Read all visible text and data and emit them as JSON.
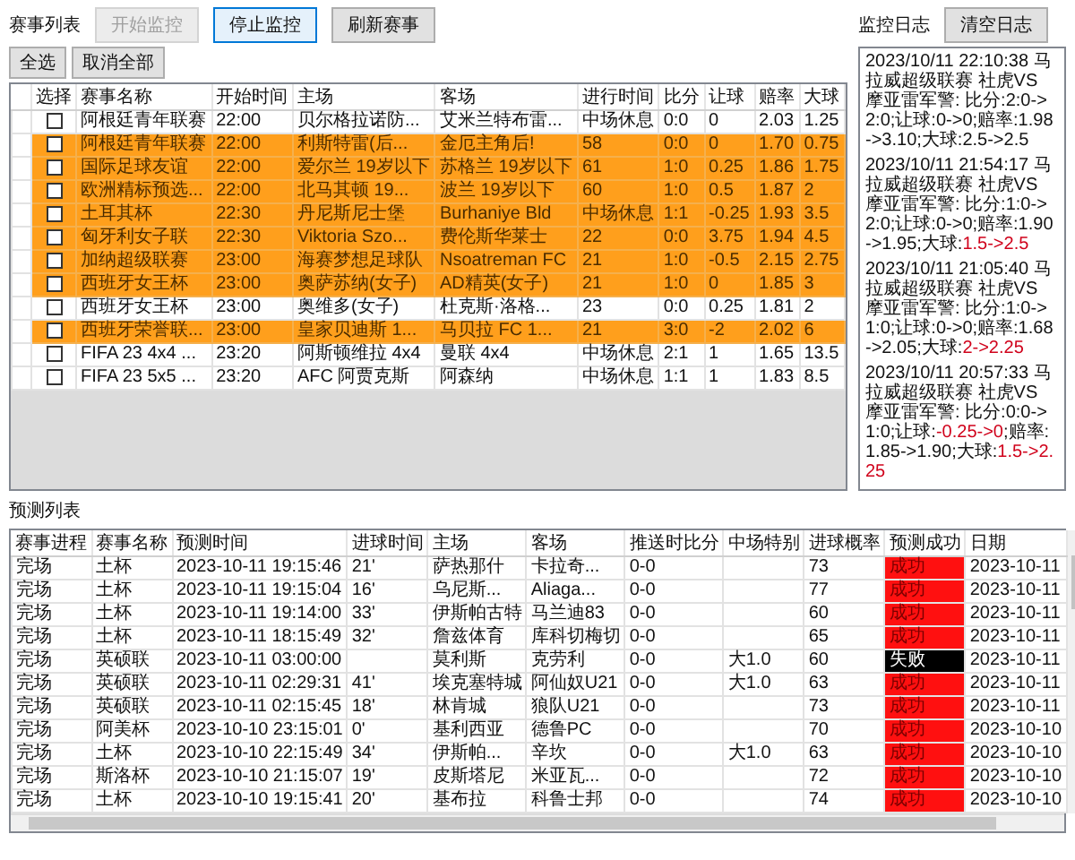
{
  "event_list": {
    "label": "赛事列表",
    "buttons": [
      {
        "label": "开始监控",
        "disabled": true,
        "focused": false
      },
      {
        "label": "停止监控",
        "disabled": false,
        "focused": true
      },
      {
        "label": "刷新赛事",
        "disabled": false,
        "focused": false
      }
    ],
    "select_buttons": [
      "全选",
      "取消全部"
    ],
    "table": {
      "columns": [
        "选择",
        "赛事名称",
        "开始时间",
        "主场",
        "客场",
        "进行时间",
        "比分",
        "让球",
        "赔率",
        "大球"
      ],
      "rows": [
        {
          "checked": false,
          "selected": false,
          "cells": [
            "",
            "阿根廷青年联赛",
            "22:00",
            "贝尔格拉诺防...",
            "艾米兰特布雷...",
            "中场休息",
            "0:0",
            "0",
            "2.03",
            "1.25"
          ]
        },
        {
          "checked": false,
          "selected": true,
          "cells": [
            "",
            "阿根廷青年联赛",
            "22:00",
            "利斯特雷(后...",
            "金厄主角后!",
            "58",
            "0:0",
            "0",
            "1.70",
            "0.75"
          ]
        },
        {
          "checked": false,
          "selected": true,
          "cells": [
            "",
            "国际足球友谊",
            "22:00",
            "爱尔兰 19岁以下",
            "苏格兰 19岁以下",
            "61",
            "1:0",
            "0.25",
            "1.86",
            "1.75"
          ]
        },
        {
          "checked": false,
          "selected": true,
          "cells": [
            "",
            "欧洲精标预选...",
            "22:00",
            "北马其顿 19...",
            "波兰 19岁以下",
            "60",
            "1:0",
            "0.5",
            "1.87",
            "2"
          ]
        },
        {
          "checked": false,
          "selected": true,
          "cells": [
            "",
            "土耳其杯",
            "22:30",
            "丹尼斯尼士堡",
            "Burhaniye Bld",
            "中场休息",
            "1:1",
            "-0.25",
            "1.93",
            "3.5"
          ]
        },
        {
          "checked": false,
          "selected": true,
          "cells": [
            "",
            "匈牙利女子联",
            "22:30",
            "Viktoria Szo...",
            "费伦斯华莱士",
            "22",
            "0:0",
            "3.75",
            "1.94",
            "4.5"
          ]
        },
        {
          "checked": false,
          "selected": true,
          "cells": [
            "",
            "加纳超级联赛",
            "23:00",
            "海赛梦想足球队",
            "Nsoatreman FC",
            "21",
            "1:0",
            "-0.5",
            "2.15",
            "2.75"
          ]
        },
        {
          "checked": false,
          "selected": true,
          "cells": [
            "",
            "西班牙女王杯",
            "23:00",
            "奥萨苏纳(女子)",
            "AD精英(女子)",
            "21",
            "1:0",
            "0",
            "1.85",
            "3"
          ]
        },
        {
          "checked": false,
          "selected": false,
          "cells": [
            "",
            "西班牙女王杯",
            "23:00",
            "奥维多(女子)",
            "杜克斯·洛格...",
            "23",
            "0:0",
            "0.25",
            "1.81",
            "2"
          ]
        },
        {
          "checked": false,
          "selected": true,
          "cells": [
            "",
            "西班牙荣誉联...",
            "23:00",
            "皇家贝迪斯 1...",
            "马贝拉 FC 1...",
            "21",
            "3:0",
            "-2",
            "2.02",
            "6"
          ]
        },
        {
          "checked": false,
          "selected": false,
          "cells": [
            "",
            "FIFA 23 4x4 ...",
            "23:20",
            "阿斯顿维拉 4x4",
            "曼联 4x4",
            "中场休息",
            "2:1",
            "1",
            "1.65",
            "13.5"
          ]
        },
        {
          "checked": false,
          "selected": false,
          "cells": [
            "",
            "FIFA 23 5x5 ...",
            "23:20",
            "AFC 阿贾克斯",
            "阿森纳",
            "中场休息",
            "1:1",
            "1",
            "1.83",
            "8.5"
          ]
        }
      ]
    }
  },
  "monitor_log": {
    "label": "监控日志",
    "clear_button": "清空日志",
    "entries": [
      {
        "segments": [
          {
            "text": "2023/10/11 22:10:38 马拉威超级联赛 社虎VS 摩亚雷军警: 比分:2:0->2:0;让球:0->0;赔率:1.98->3.10;大球:2.5->2.5",
            "changed": false
          }
        ]
      },
      {
        "segments": [
          {
            "text": "2023/10/11 21:54:17 马拉威超级联赛 社虎VS 摩亚雷军警: 比分:1:0->2:0;让球:0->0;赔率:1.90->1.95;大球:",
            "changed": false
          },
          {
            "text": "1.5->2.5",
            "changed": true
          }
        ]
      },
      {
        "segments": [
          {
            "text": "2023/10/11 21:05:40 马拉威超级联赛 社虎VS 摩亚雷军警: 比分:1:0->1:0;让球:0->0;赔率:1.68->2.05;大球:",
            "changed": false
          },
          {
            "text": "2->2.25",
            "changed": true
          }
        ]
      },
      {
        "segments": [
          {
            "text": "2023/10/11 20:57:33 马拉威超级联赛 社虎VS 摩亚雷军警: 比分:0:0->1:0;让球:",
            "changed": false
          },
          {
            "text": "-0.25->0",
            "changed": true
          },
          {
            "text": ";赔率:1.85->1.90;大球:",
            "changed": false
          },
          {
            "text": "1.5->2.25",
            "changed": true
          }
        ]
      }
    ]
  },
  "prediction_list": {
    "label": "预测列表",
    "table": {
      "columns": [
        "赛事进程",
        "赛事名称",
        "预测时间",
        "进球时间",
        "主场",
        "客场",
        "推送时比分",
        "中场特别",
        "进球概率",
        "预测成功",
        "日期"
      ],
      "rows": [
        {
          "success": true,
          "cells": [
            "完场",
            "土杯",
            "2023-10-11 19:15:46",
            "21'",
            "萨热那什",
            "卡拉奇...",
            "0-0",
            "",
            "73",
            "成功",
            "2023-10-11"
          ]
        },
        {
          "success": true,
          "cells": [
            "完场",
            "土杯",
            "2023-10-11 19:15:04",
            "16'",
            "乌尼斯...",
            "Aliaga...",
            "0-0",
            "",
            "77",
            "成功",
            "2023-10-11"
          ]
        },
        {
          "success": true,
          "cells": [
            "完场",
            "土杯",
            "2023-10-11 19:14:00",
            "33'",
            "伊斯帕古特",
            "马兰迪83",
            "0-0",
            "",
            "60",
            "成功",
            "2023-10-11"
          ]
        },
        {
          "success": true,
          "cells": [
            "完场",
            "土杯",
            "2023-10-11 18:15:49",
            "32'",
            "詹兹体育",
            "库科切梅切",
            "0-0",
            "",
            "65",
            "成功",
            "2023-10-11"
          ]
        },
        {
          "success": false,
          "cells": [
            "完场",
            "英硕联",
            "2023-10-11 03:00:00",
            "",
            "莫利斯",
            "克劳利",
            "0-0",
            "大1.0",
            "60",
            "失败",
            "2023-10-11"
          ]
        },
        {
          "success": true,
          "cells": [
            "完场",
            "英硕联",
            "2023-10-11 02:29:31",
            "41'",
            "埃克塞特城",
            "阿仙奴U21",
            "0-0",
            "大1.0",
            "63",
            "成功",
            "2023-10-11"
          ]
        },
        {
          "success": true,
          "cells": [
            "完场",
            "英硕联",
            "2023-10-11 02:15:45",
            "18'",
            "林肯城",
            "狼队U21",
            "0-0",
            "",
            "73",
            "成功",
            "2023-10-11"
          ]
        },
        {
          "success": true,
          "cells": [
            "完场",
            "阿美杯",
            "2023-10-10 23:15:01",
            "0'",
            "基利西亚",
            "德鲁PC",
            "0-0",
            "",
            "70",
            "成功",
            "2023-10-10"
          ]
        },
        {
          "success": true,
          "cells": [
            "完场",
            "土杯",
            "2023-10-10 22:15:49",
            "34'",
            "伊斯帕...",
            "辛坎",
            "0-0",
            "大1.0",
            "63",
            "成功",
            "2023-10-10"
          ]
        },
        {
          "success": true,
          "cells": [
            "完场",
            "斯洛杯",
            "2023-10-10 21:15:07",
            "19'",
            "皮斯塔尼",
            "米亚瓦...",
            "0-0",
            "",
            "72",
            "成功",
            "2023-10-10"
          ]
        },
        {
          "success": true,
          "cells": [
            "完场",
            "土杯",
            "2023-10-10 19:15:41",
            "20'",
            "基布拉",
            "科鲁士邦",
            "0-0",
            "",
            "74",
            "成功",
            "2023-10-10"
          ]
        }
      ]
    }
  }
}
